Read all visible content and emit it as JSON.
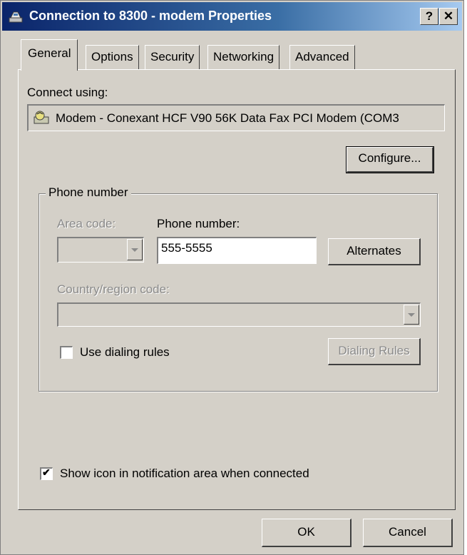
{
  "window": {
    "title": "Connection to 8300 - modem Properties"
  },
  "titlebar": {
    "help_label": "?",
    "close_label": "✕"
  },
  "tabs": [
    {
      "label": "General"
    },
    {
      "label": "Options"
    },
    {
      "label": "Security"
    },
    {
      "label": "Networking"
    },
    {
      "label": "Advanced"
    }
  ],
  "general": {
    "connect_using_label": "Connect using:",
    "device_name": "Modem - Conexant HCF V90 56K Data Fax PCI Modem (COM3",
    "configure_label": "Configure...",
    "phone_group_label": "Phone number",
    "area_code_label": "Area code:",
    "area_code_value": "",
    "phone_number_label": "Phone number:",
    "phone_number_value": "555-5555",
    "alternates_label": "Alternates",
    "country_label": "Country/region code:",
    "country_value": "",
    "use_dialing_rules_label": "Use dialing rules",
    "use_dialing_rules_checked": false,
    "dialing_rules_label": "Dialing Rules",
    "show_icon_label": "Show icon in notification area when connected",
    "show_icon_checked": true
  },
  "footer": {
    "ok_label": "OK",
    "cancel_label": "Cancel"
  }
}
